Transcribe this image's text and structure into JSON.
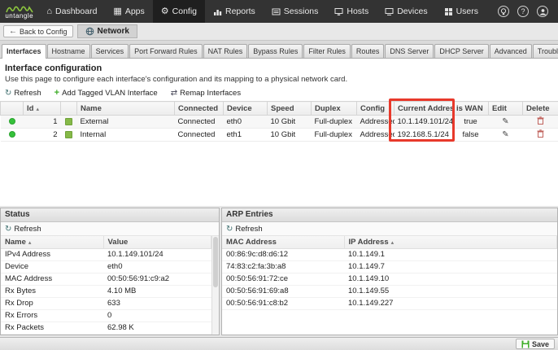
{
  "colors": {
    "accent_green": "#8dc63f",
    "highlight_red": "#e8392b",
    "status_green": "#35c13a"
  },
  "topnav": {
    "logo_text": "untangle",
    "items": [
      {
        "label": "Dashboard"
      },
      {
        "label": "Apps"
      },
      {
        "label": "Config"
      },
      {
        "label": "Reports"
      }
    ],
    "right_items": [
      {
        "label": "Sessions"
      },
      {
        "label": "Hosts"
      },
      {
        "label": "Devices"
      },
      {
        "label": "Users"
      }
    ]
  },
  "subbar": {
    "back_label": "Back to Config",
    "section_label": "Network"
  },
  "tabs": [
    {
      "label": "Interfaces"
    },
    {
      "label": "Hostname"
    },
    {
      "label": "Services"
    },
    {
      "label": "Port Forward Rules"
    },
    {
      "label": "NAT Rules"
    },
    {
      "label": "Bypass Rules"
    },
    {
      "label": "Filter Rules"
    },
    {
      "label": "Routes"
    },
    {
      "label": "DNS Server"
    },
    {
      "label": "DHCP Server"
    },
    {
      "label": "Advanced"
    },
    {
      "label": "Troubleshooting"
    }
  ],
  "page": {
    "title": "Interface configuration",
    "description": "Use this page to configure each interface's configuration and its mapping to a physical network card."
  },
  "toolbar": {
    "refresh": "Refresh",
    "add_vlan": "Add Tagged VLAN Interface",
    "remap": "Remap Interfaces"
  },
  "interfaces": {
    "headers": {
      "id": "Id",
      "name": "Name",
      "connected": "Connected",
      "device": "Device",
      "speed": "Speed",
      "duplex": "Duplex",
      "config": "Config",
      "address": "Current Address",
      "wan": "is WAN",
      "edit": "Edit",
      "delete": "Delete"
    },
    "rows": [
      {
        "id": "1",
        "name": "External",
        "connected": "Connected",
        "device": "eth0",
        "speed": "10 Gbit",
        "duplex": "Full-duplex",
        "config": "Addressed",
        "address": "10.1.149.101/24",
        "wan": "true"
      },
      {
        "id": "2",
        "name": "Internal",
        "connected": "Connected",
        "device": "eth1",
        "speed": "10 Gbit",
        "duplex": "Full-duplex",
        "config": "Addressed",
        "address": "192.168.5.1/24",
        "wan": "false"
      }
    ]
  },
  "status_panel": {
    "title": "Status",
    "refresh": "Refresh",
    "headers": {
      "name": "Name",
      "value": "Value"
    },
    "rows": [
      {
        "name": "IPv4 Address",
        "value": "10.1.149.101/24"
      },
      {
        "name": "Device",
        "value": "eth0"
      },
      {
        "name": "MAC Address",
        "value": "00:50:56:91:c9:a2"
      },
      {
        "name": "Rx Bytes",
        "value": "4.10 MB"
      },
      {
        "name": "Rx Drop",
        "value": "633"
      },
      {
        "name": "Rx Errors",
        "value": "0"
      },
      {
        "name": "Rx Packets",
        "value": "62.98 K"
      }
    ]
  },
  "arp_panel": {
    "title": "ARP Entries",
    "refresh": "Refresh",
    "headers": {
      "mac": "MAC Address",
      "ip": "IP Address"
    },
    "rows": [
      {
        "mac": "00:86:9c:d8:d6:12",
        "ip": "10.1.149.1"
      },
      {
        "mac": "74:83:c2:fa:3b:a8",
        "ip": "10.1.149.7"
      },
      {
        "mac": "00:50:56:91:72:ce",
        "ip": "10.1.149.10"
      },
      {
        "mac": "00:50:56:91:69:a8",
        "ip": "10.1.149.55"
      },
      {
        "mac": "00:50:56:91:c8:b2",
        "ip": "10.1.149.227"
      }
    ]
  },
  "footer": {
    "save": "Save"
  }
}
